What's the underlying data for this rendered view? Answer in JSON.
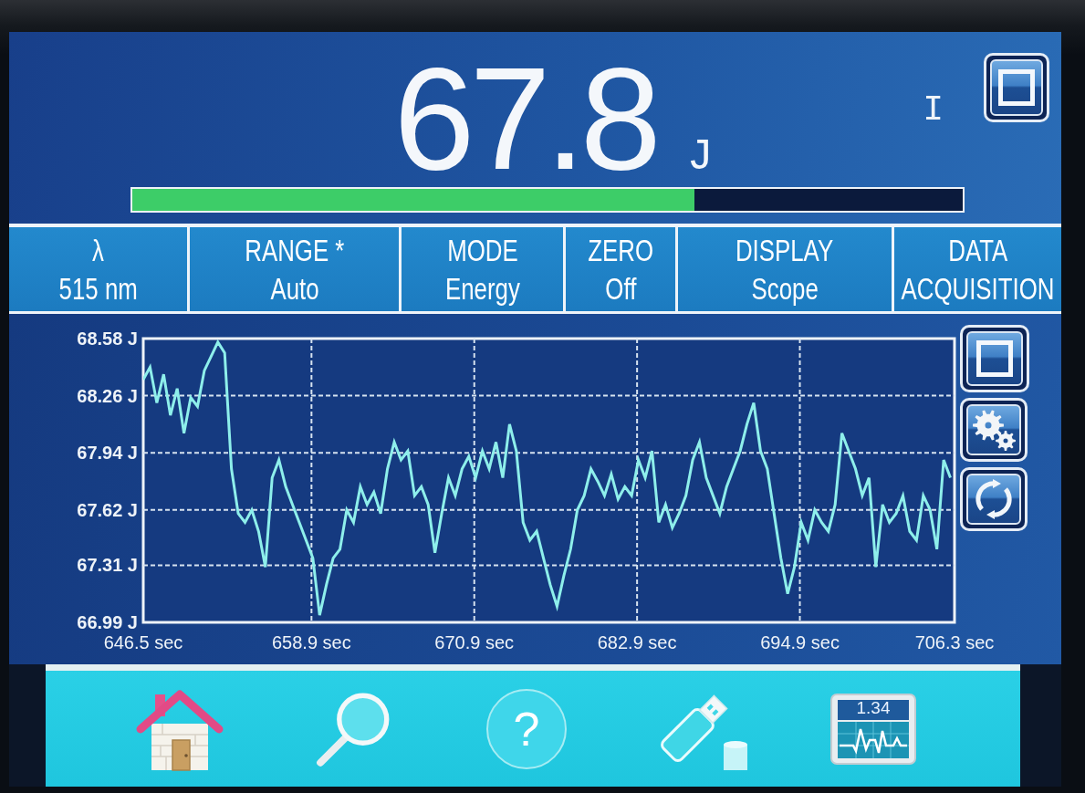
{
  "reading": {
    "value": "67.8",
    "unit": "J",
    "level": 0.677
  },
  "indicator": "I",
  "settings": [
    {
      "lines": [
        "λ",
        "515 nm"
      ]
    },
    {
      "lines": [
        "RANGE *",
        "Auto"
      ]
    },
    {
      "lines": [
        "MODE",
        "Energy"
      ]
    },
    {
      "lines": [
        "ZERO",
        "Off"
      ]
    },
    {
      "lines": [
        "DISPLAY",
        "Scope"
      ]
    },
    {
      "lines": [
        "DATA",
        "ACQUISITION"
      ]
    }
  ],
  "chart": {
    "chart_data": {
      "type": "line",
      "grid": true,
      "xlim": [
        646.5,
        706.3
      ],
      "ylim": [
        66.99,
        68.58
      ],
      "xticks": [
        {
          "value": 646.5,
          "label": "646.5 sec"
        },
        {
          "value": 658.9,
          "label": "658.9 sec"
        },
        {
          "value": 670.9,
          "label": "670.9 sec"
        },
        {
          "value": 682.9,
          "label": "682.9 sec"
        },
        {
          "value": 694.9,
          "label": "694.9 sec"
        },
        {
          "value": 706.3,
          "label": "706.3 sec"
        }
      ],
      "yticks": [
        {
          "value": 68.58,
          "label": "68.58 J"
        },
        {
          "value": 68.26,
          "label": "68.26 J"
        },
        {
          "value": 67.94,
          "label": "67.94 J"
        },
        {
          "value": 67.62,
          "label": "67.62 J"
        },
        {
          "value": 67.31,
          "label": "67.31 J"
        },
        {
          "value": 66.99,
          "label": "66.99 J"
        }
      ],
      "x": [
        646.5,
        647,
        647.5,
        648,
        648.5,
        649,
        649.5,
        650,
        650.5,
        651,
        651.5,
        652,
        652.5,
        653,
        653.5,
        654,
        654.5,
        655,
        655.5,
        656,
        656.5,
        657,
        657.5,
        658,
        658.5,
        659,
        659.5,
        660,
        660.5,
        661,
        661.5,
        662,
        662.5,
        663,
        663.5,
        664,
        664.5,
        665,
        665.5,
        666,
        666.5,
        667,
        667.5,
        668,
        668.5,
        669,
        669.5,
        670,
        670.5,
        671,
        671.5,
        672,
        672.5,
        673,
        673.5,
        674,
        674.5,
        675,
        675.5,
        676,
        676.5,
        677,
        677.5,
        678,
        678.5,
        679,
        679.5,
        680,
        680.5,
        681,
        681.5,
        682,
        682.5,
        683,
        683.5,
        684,
        684.5,
        685,
        685.5,
        686,
        686.5,
        687,
        687.5,
        688,
        688.5,
        689,
        689.5,
        690,
        690.5,
        691,
        691.5,
        692,
        692.5,
        693,
        693.5,
        694,
        694.5,
        695,
        695.5,
        696,
        696.5,
        697,
        697.5,
        698,
        698.5,
        699,
        699.5,
        700,
        700.5,
        701,
        701.5,
        702,
        702.5,
        703,
        703.5,
        704,
        704.5,
        705,
        705.5,
        706
      ],
      "series": [
        {
          "color": "#8eefeb",
          "values": [
            68.35,
            68.42,
            68.22,
            68.38,
            68.15,
            68.3,
            68.05,
            68.25,
            68.2,
            68.4,
            68.48,
            68.56,
            68.5,
            67.85,
            67.6,
            67.55,
            67.62,
            67.5,
            67.3,
            67.8,
            67.9,
            67.75,
            67.65,
            67.55,
            67.45,
            67.35,
            67.03,
            67.2,
            67.35,
            67.4,
            67.62,
            67.55,
            67.75,
            67.65,
            67.72,
            67.6,
            67.85,
            68.0,
            67.9,
            67.95,
            67.7,
            67.75,
            67.65,
            67.38,
            67.6,
            67.8,
            67.7,
            67.85,
            67.92,
            67.8,
            67.95,
            67.85,
            68.0,
            67.8,
            68.1,
            67.95,
            67.55,
            67.45,
            67.5,
            67.35,
            67.2,
            67.08,
            67.25,
            67.4,
            67.62,
            67.7,
            67.85,
            67.78,
            67.7,
            67.82,
            67.68,
            67.75,
            67.7,
            67.9,
            67.8,
            67.95,
            67.55,
            67.65,
            67.52,
            67.6,
            67.7,
            67.9,
            68.0,
            67.8,
            67.7,
            67.6,
            67.75,
            67.85,
            67.95,
            68.1,
            68.22,
            67.95,
            67.85,
            67.6,
            67.35,
            67.15,
            67.3,
            67.55,
            67.45,
            67.62,
            67.55,
            67.5,
            67.65,
            68.05,
            67.95,
            67.85,
            67.7,
            67.8,
            67.3,
            67.65,
            67.55,
            67.6,
            67.7,
            67.5,
            67.45,
            67.7,
            67.62,
            67.4,
            67.9,
            67.8
          ]
        }
      ]
    }
  },
  "side_buttons": [
    {
      "kind": "square"
    },
    {
      "kind": "settings"
    },
    {
      "kind": "refresh"
    }
  ],
  "toolbar": [
    {
      "kind": "home"
    },
    {
      "kind": "search"
    },
    {
      "kind": "help",
      "label": "?"
    },
    {
      "kind": "usb"
    },
    {
      "kind": "monitor",
      "readout": "1.34"
    }
  ]
}
